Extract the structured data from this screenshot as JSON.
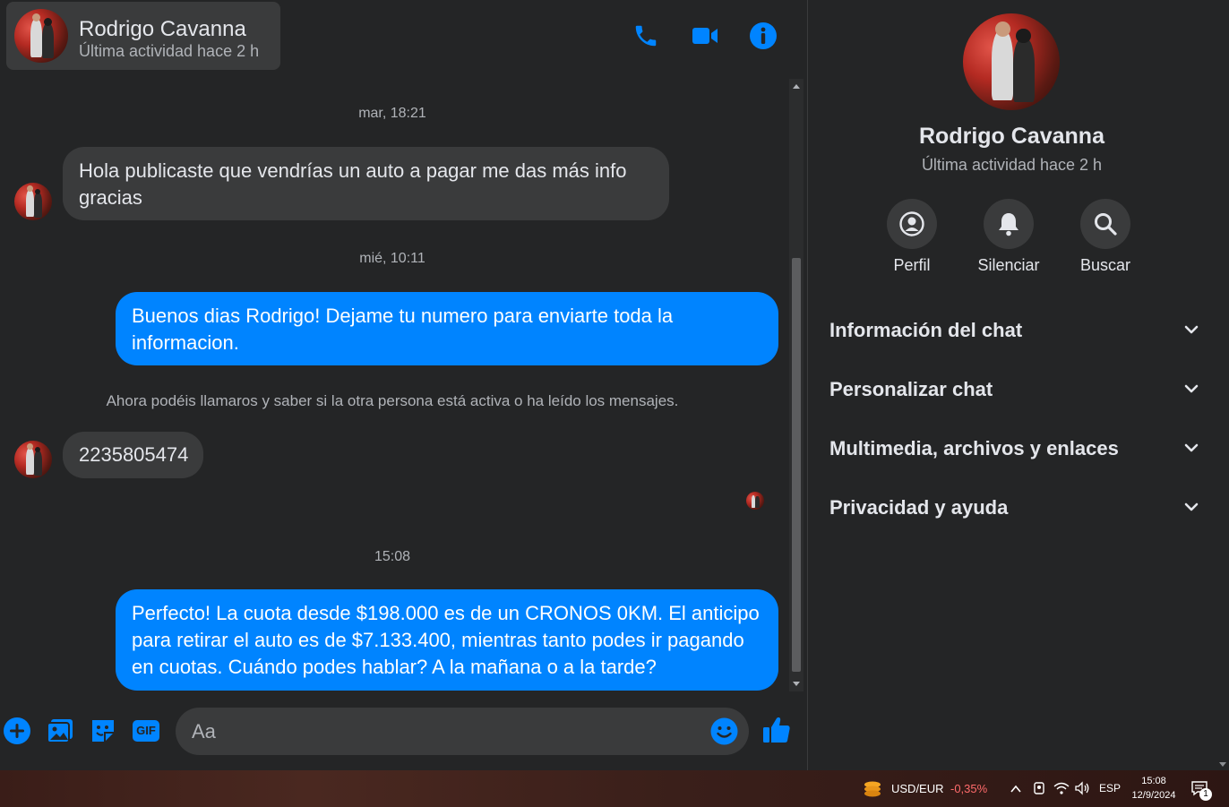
{
  "contact": {
    "name": "Rodrigo Cavanna",
    "status": "Última actividad hace 2 h"
  },
  "header_icons": [
    "phone-icon",
    "video-camera-icon",
    "info-icon"
  ],
  "conversation": {
    "stamps": [
      "mar, 18:21",
      "mié, 10:11",
      "15:08"
    ],
    "messages": [
      "Hola publicaste que vendrías un auto a pagar me das más info gracias",
      "Buenos dias Rodrigo! Dejame tu numero para enviarte toda la informacion.",
      "2235805474",
      "Perfecto! La cuota desde $198.000 es de un CRONOS 0KM. El anticipo para retirar el auto es de $7.133.400, mientras tanto podes ir pagando en cuotas. Cuándo podes hablar? A la mañana o a la tarde?"
    ],
    "system_notice": "Ahora podéis llamaros y saber si la otra persona está activa o ha leído los mensajes."
  },
  "composer": {
    "placeholder": "Aa",
    "icons": [
      "plus-icon",
      "image-icon",
      "sticker-icon",
      "gif-icon",
      "emoji-icon",
      "like-icon"
    ],
    "gif_label": "GIF"
  },
  "info_panel": {
    "actions": [
      "Perfil",
      "Silenciar",
      "Buscar"
    ],
    "sections": [
      "Información del chat",
      "Personalizar chat",
      "Multimedia, archivos y enlaces",
      "Privacidad y ayuda"
    ]
  },
  "taskbar": {
    "currency": "USD/EUR",
    "change": "-0,35%",
    "language": "ESP",
    "time": "15:08",
    "date": "12/9/2024",
    "notifications": "1"
  },
  "colors": {
    "accent": "#0084ff",
    "background": "#242526",
    "incoming_bubble": "#3a3b3c",
    "negative": "#ff6b6b"
  }
}
